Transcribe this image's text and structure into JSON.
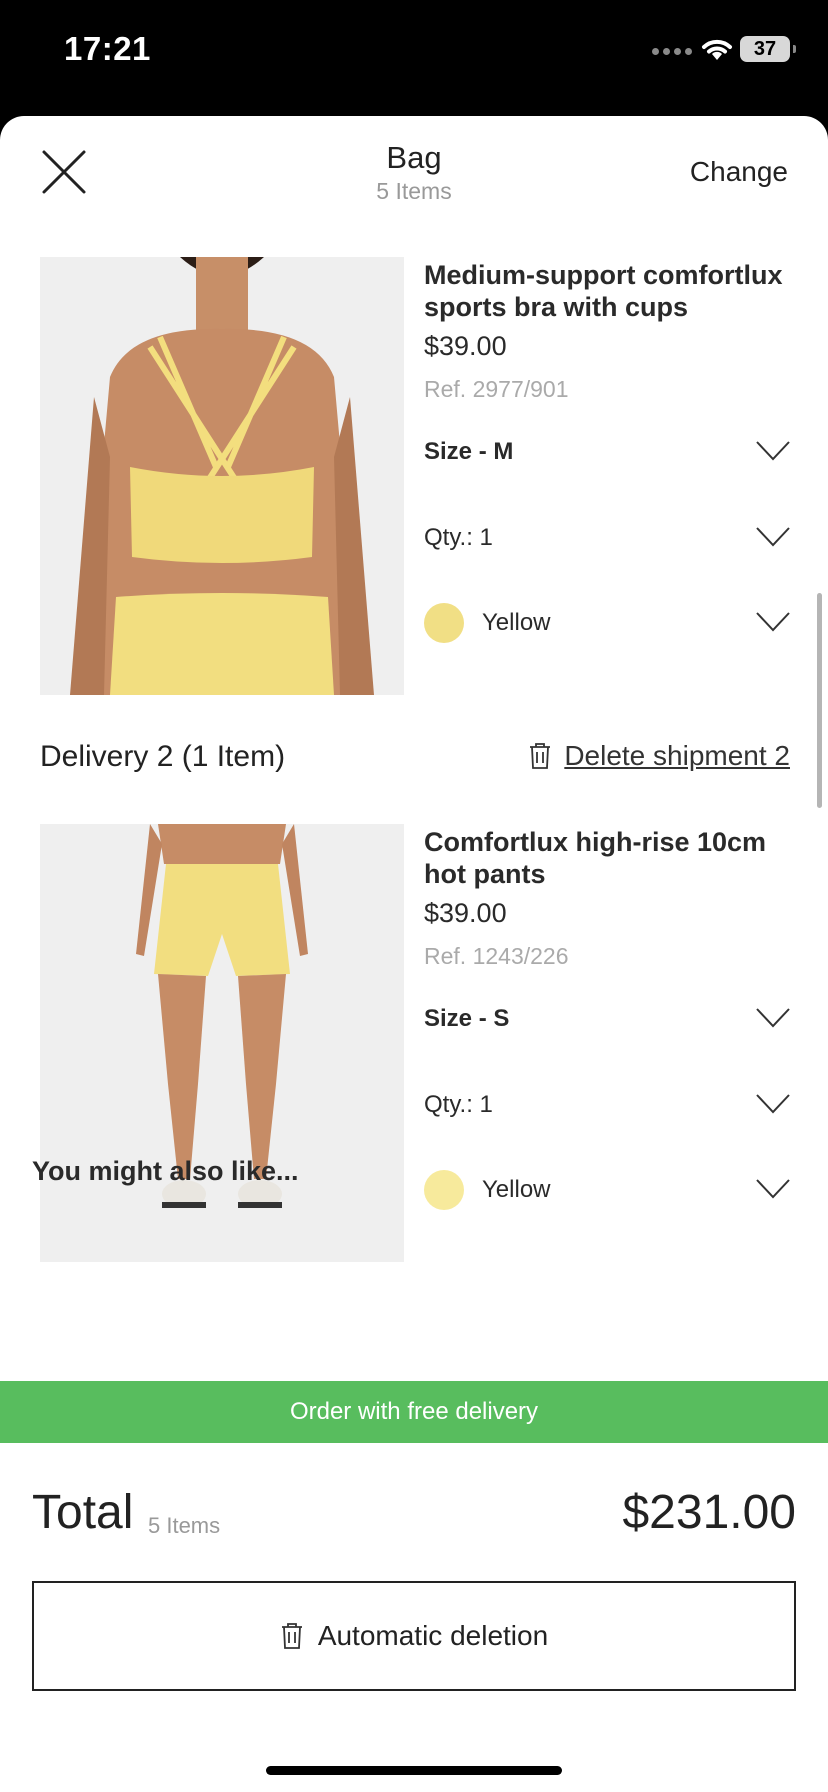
{
  "status": {
    "time": "17:21",
    "battery": "37"
  },
  "header": {
    "title": "Bag",
    "subtitle": "5 Items",
    "change_label": "Change"
  },
  "products": [
    {
      "name": "Medium-support comfortlux sports bra with cups",
      "price": "$39.00",
      "ref": "Ref. 2977/901",
      "size": "Size - M",
      "qty": "Qty.: 1",
      "color_name": "Yellow",
      "swatch_color": "#f1df85"
    },
    {
      "name": "Comfortlux high-rise 10cm hot pants",
      "price": "$39.00",
      "ref": "Ref. 1243/226",
      "size": "Size - S",
      "qty": "Qty.: 1",
      "color_name": "Yellow",
      "swatch_color": "#f7ea9c"
    }
  ],
  "delivery2": {
    "title": "Delivery 2 (1 Item)",
    "delete_label": "Delete shipment 2"
  },
  "recommendations": {
    "title": "You might also like..."
  },
  "banner": {
    "label": "Order with free delivery",
    "color": "#58bd5e"
  },
  "footer": {
    "total_label": "Total",
    "total_items": "5 Items",
    "total_price": "$231.00",
    "auto_delete_label": "Automatic deletion"
  },
  "icons": [
    "close-icon",
    "chevron-down-icon",
    "trash-icon",
    "wifi-icon",
    "battery-icon"
  ]
}
